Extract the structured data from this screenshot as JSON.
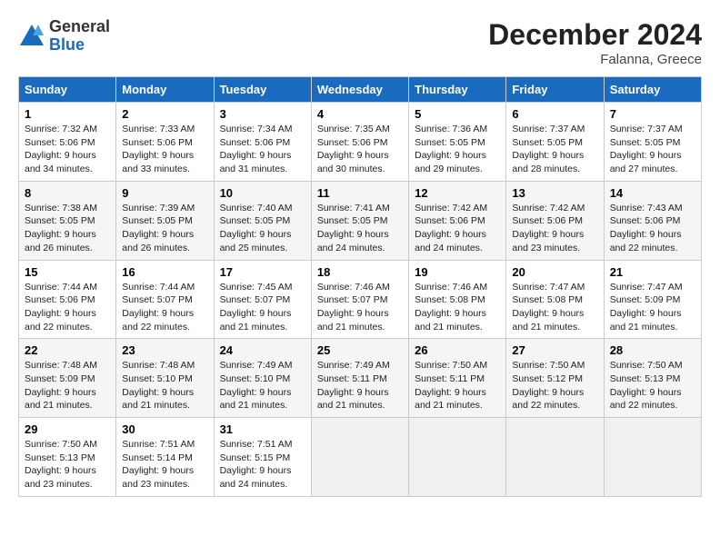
{
  "header": {
    "logo_line1": "General",
    "logo_line2": "Blue",
    "month_title": "December 2024",
    "location": "Falanna, Greece"
  },
  "weekdays": [
    "Sunday",
    "Monday",
    "Tuesday",
    "Wednesday",
    "Thursday",
    "Friday",
    "Saturday"
  ],
  "weeks": [
    [
      {
        "day": "1",
        "sunrise": "Sunrise: 7:32 AM",
        "sunset": "Sunset: 5:06 PM",
        "daylight": "Daylight: 9 hours and 34 minutes."
      },
      {
        "day": "2",
        "sunrise": "Sunrise: 7:33 AM",
        "sunset": "Sunset: 5:06 PM",
        "daylight": "Daylight: 9 hours and 33 minutes."
      },
      {
        "day": "3",
        "sunrise": "Sunrise: 7:34 AM",
        "sunset": "Sunset: 5:06 PM",
        "daylight": "Daylight: 9 hours and 31 minutes."
      },
      {
        "day": "4",
        "sunrise": "Sunrise: 7:35 AM",
        "sunset": "Sunset: 5:06 PM",
        "daylight": "Daylight: 9 hours and 30 minutes."
      },
      {
        "day": "5",
        "sunrise": "Sunrise: 7:36 AM",
        "sunset": "Sunset: 5:05 PM",
        "daylight": "Daylight: 9 hours and 29 minutes."
      },
      {
        "day": "6",
        "sunrise": "Sunrise: 7:37 AM",
        "sunset": "Sunset: 5:05 PM",
        "daylight": "Daylight: 9 hours and 28 minutes."
      },
      {
        "day": "7",
        "sunrise": "Sunrise: 7:37 AM",
        "sunset": "Sunset: 5:05 PM",
        "daylight": "Daylight: 9 hours and 27 minutes."
      }
    ],
    [
      {
        "day": "8",
        "sunrise": "Sunrise: 7:38 AM",
        "sunset": "Sunset: 5:05 PM",
        "daylight": "Daylight: 9 hours and 26 minutes."
      },
      {
        "day": "9",
        "sunrise": "Sunrise: 7:39 AM",
        "sunset": "Sunset: 5:05 PM",
        "daylight": "Daylight: 9 hours and 26 minutes."
      },
      {
        "day": "10",
        "sunrise": "Sunrise: 7:40 AM",
        "sunset": "Sunset: 5:05 PM",
        "daylight": "Daylight: 9 hours and 25 minutes."
      },
      {
        "day": "11",
        "sunrise": "Sunrise: 7:41 AM",
        "sunset": "Sunset: 5:05 PM",
        "daylight": "Daylight: 9 hours and 24 minutes."
      },
      {
        "day": "12",
        "sunrise": "Sunrise: 7:42 AM",
        "sunset": "Sunset: 5:06 PM",
        "daylight": "Daylight: 9 hours and 24 minutes."
      },
      {
        "day": "13",
        "sunrise": "Sunrise: 7:42 AM",
        "sunset": "Sunset: 5:06 PM",
        "daylight": "Daylight: 9 hours and 23 minutes."
      },
      {
        "day": "14",
        "sunrise": "Sunrise: 7:43 AM",
        "sunset": "Sunset: 5:06 PM",
        "daylight": "Daylight: 9 hours and 22 minutes."
      }
    ],
    [
      {
        "day": "15",
        "sunrise": "Sunrise: 7:44 AM",
        "sunset": "Sunset: 5:06 PM",
        "daylight": "Daylight: 9 hours and 22 minutes."
      },
      {
        "day": "16",
        "sunrise": "Sunrise: 7:44 AM",
        "sunset": "Sunset: 5:07 PM",
        "daylight": "Daylight: 9 hours and 22 minutes."
      },
      {
        "day": "17",
        "sunrise": "Sunrise: 7:45 AM",
        "sunset": "Sunset: 5:07 PM",
        "daylight": "Daylight: 9 hours and 21 minutes."
      },
      {
        "day": "18",
        "sunrise": "Sunrise: 7:46 AM",
        "sunset": "Sunset: 5:07 PM",
        "daylight": "Daylight: 9 hours and 21 minutes."
      },
      {
        "day": "19",
        "sunrise": "Sunrise: 7:46 AM",
        "sunset": "Sunset: 5:08 PM",
        "daylight": "Daylight: 9 hours and 21 minutes."
      },
      {
        "day": "20",
        "sunrise": "Sunrise: 7:47 AM",
        "sunset": "Sunset: 5:08 PM",
        "daylight": "Daylight: 9 hours and 21 minutes."
      },
      {
        "day": "21",
        "sunrise": "Sunrise: 7:47 AM",
        "sunset": "Sunset: 5:09 PM",
        "daylight": "Daylight: 9 hours and 21 minutes."
      }
    ],
    [
      {
        "day": "22",
        "sunrise": "Sunrise: 7:48 AM",
        "sunset": "Sunset: 5:09 PM",
        "daylight": "Daylight: 9 hours and 21 minutes."
      },
      {
        "day": "23",
        "sunrise": "Sunrise: 7:48 AM",
        "sunset": "Sunset: 5:10 PM",
        "daylight": "Daylight: 9 hours and 21 minutes."
      },
      {
        "day": "24",
        "sunrise": "Sunrise: 7:49 AM",
        "sunset": "Sunset: 5:10 PM",
        "daylight": "Daylight: 9 hours and 21 minutes."
      },
      {
        "day": "25",
        "sunrise": "Sunrise: 7:49 AM",
        "sunset": "Sunset: 5:11 PM",
        "daylight": "Daylight: 9 hours and 21 minutes."
      },
      {
        "day": "26",
        "sunrise": "Sunrise: 7:50 AM",
        "sunset": "Sunset: 5:11 PM",
        "daylight": "Daylight: 9 hours and 21 minutes."
      },
      {
        "day": "27",
        "sunrise": "Sunrise: 7:50 AM",
        "sunset": "Sunset: 5:12 PM",
        "daylight": "Daylight: 9 hours and 22 minutes."
      },
      {
        "day": "28",
        "sunrise": "Sunrise: 7:50 AM",
        "sunset": "Sunset: 5:13 PM",
        "daylight": "Daylight: 9 hours and 22 minutes."
      }
    ],
    [
      {
        "day": "29",
        "sunrise": "Sunrise: 7:50 AM",
        "sunset": "Sunset: 5:13 PM",
        "daylight": "Daylight: 9 hours and 23 minutes."
      },
      {
        "day": "30",
        "sunrise": "Sunrise: 7:51 AM",
        "sunset": "Sunset: 5:14 PM",
        "daylight": "Daylight: 9 hours and 23 minutes."
      },
      {
        "day": "31",
        "sunrise": "Sunrise: 7:51 AM",
        "sunset": "Sunset: 5:15 PM",
        "daylight": "Daylight: 9 hours and 24 minutes."
      },
      null,
      null,
      null,
      null
    ]
  ]
}
